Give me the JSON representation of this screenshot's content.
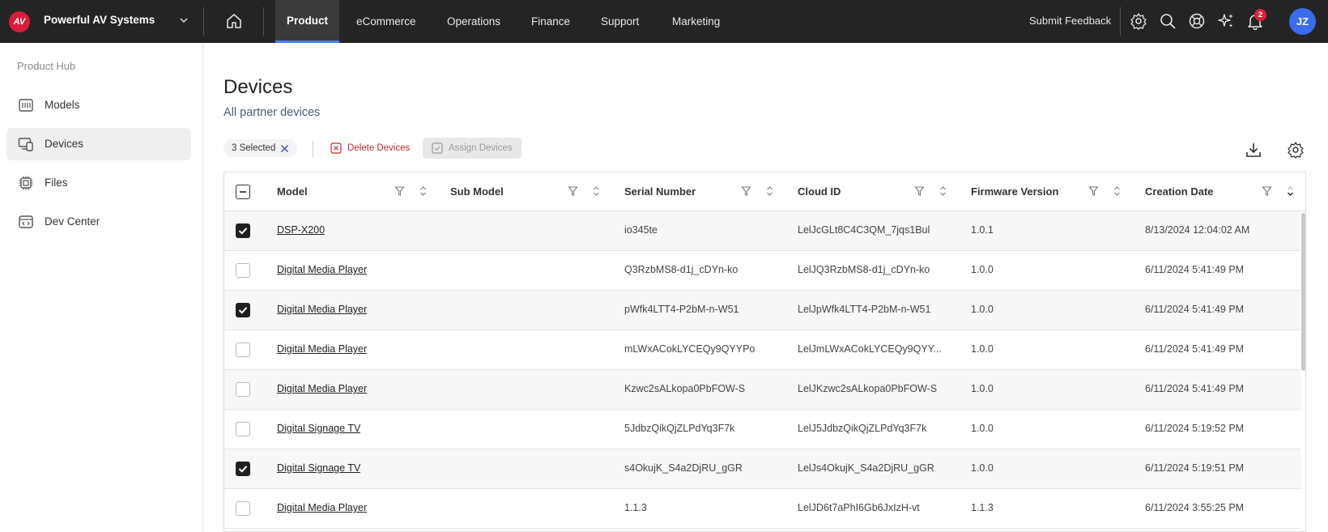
{
  "header": {
    "logo_text": "AV",
    "org_name": "Powerful AV Systems",
    "tabs": [
      {
        "label": "Product",
        "active": true
      },
      {
        "label": "eCommerce",
        "active": false
      },
      {
        "label": "Operations",
        "active": false
      },
      {
        "label": "Finance",
        "active": false
      },
      {
        "label": "Support",
        "active": false
      },
      {
        "label": "Marketing",
        "active": false
      }
    ],
    "feedback_label": "Submit Feedback",
    "notification_count": "2",
    "avatar_initials": "JZ",
    "accent_color": "#4a7cff"
  },
  "sidebar": {
    "title": "Product Hub",
    "items": [
      {
        "label": "Models",
        "icon": "models-icon",
        "active": false
      },
      {
        "label": "Devices",
        "icon": "devices-icon",
        "active": true
      },
      {
        "label": "Files",
        "icon": "files-icon",
        "active": false
      },
      {
        "label": "Dev Center",
        "icon": "dev-center-icon",
        "active": false
      }
    ]
  },
  "main": {
    "title": "Devices",
    "subtitle": "All partner devices",
    "toolbar": {
      "selected_label": "3 Selected",
      "delete_label": "Delete Devices",
      "assign_label": "Assign Devices"
    }
  },
  "table": {
    "columns": [
      "Model",
      "Sub Model",
      "Serial Number",
      "Cloud ID",
      "Firmware Version",
      "Creation Date"
    ],
    "rows": [
      {
        "checked": true,
        "model": "DSP-X200",
        "sub_model": "",
        "serial": "io345te",
        "cloud_id": "LelJcGLt8C4C3QM_7jqs1Bul",
        "firmware": "1.0.1",
        "created": "8/13/2024 12:04:02 AM"
      },
      {
        "checked": false,
        "model": "Digital Media Player",
        "sub_model": "",
        "serial": "Q3RzbMS8-d1j_cDYn-ko",
        "cloud_id": "LelJQ3RzbMS8-d1j_cDYn-ko",
        "firmware": "1.0.0",
        "created": "6/11/2024 5:41:49 PM"
      },
      {
        "checked": true,
        "model": "Digital Media Player",
        "sub_model": "",
        "serial": "pWfk4LTT4-P2bM-n-W51",
        "cloud_id": "LelJpWfk4LTT4-P2bM-n-W51",
        "firmware": "1.0.0",
        "created": "6/11/2024 5:41:49 PM"
      },
      {
        "checked": false,
        "model": "Digital Media Player",
        "sub_model": "",
        "serial": "mLWxACokLYCEQy9QYYPo",
        "cloud_id": "LelJmLWxACokLYCEQy9QYY...",
        "firmware": "1.0.0",
        "created": "6/11/2024 5:41:49 PM"
      },
      {
        "checked": false,
        "model": "Digital Media Player",
        "sub_model": "",
        "serial": "Kzwc2sALkopa0PbFOW-S",
        "cloud_id": "LelJKzwc2sALkopa0PbFOW-S",
        "firmware": "1.0.0",
        "created": "6/11/2024 5:41:49 PM"
      },
      {
        "checked": false,
        "model": "Digital Signage TV",
        "sub_model": "",
        "serial": "5JdbzQikQjZLPdYq3F7k",
        "cloud_id": "LelJ5JdbzQikQjZLPdYq3F7k",
        "firmware": "1.0.0",
        "created": "6/11/2024 5:19:52 PM"
      },
      {
        "checked": true,
        "model": "Digital Signage TV",
        "sub_model": "",
        "serial": "s4OkujK_S4a2DjRU_gGR",
        "cloud_id": "LelJs4OkujK_S4a2DjRU_gGR",
        "firmware": "1.0.0",
        "created": "6/11/2024 5:19:51 PM"
      },
      {
        "checked": false,
        "model": "Digital Media Player",
        "sub_model": "",
        "serial": "1.1.3",
        "cloud_id": "LelJD6t7aPhI6Gb6JxIzH-vt",
        "firmware": "1.1.3",
        "created": "6/11/2024 3:55:25 PM"
      }
    ]
  }
}
